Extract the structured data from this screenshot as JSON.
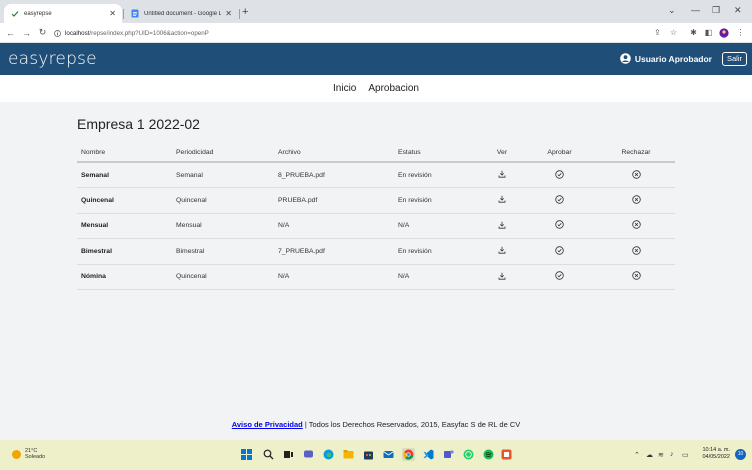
{
  "browser": {
    "tabs": [
      {
        "title": "easyrepse",
        "active": true
      },
      {
        "title": "Untitled document - Google Doc",
        "active": false
      }
    ],
    "url_host": "localhost",
    "url_path": "/repse/index.php?UID=1006&action=openP"
  },
  "header": {
    "brand": "easyrepse",
    "user_name": "Usuario Aprobador",
    "logout_label": "Salir",
    "color": "#1f4e79"
  },
  "nav": {
    "items": [
      "Inicio",
      "Aprobacion"
    ]
  },
  "main": {
    "title": "Empresa 1 2022-02",
    "columns": [
      "Nombre",
      "Periodicidad",
      "Archivo",
      "Estatus",
      "Ver",
      "Aprobar",
      "Rechazar"
    ],
    "rows": [
      {
        "nombre": "Semanal",
        "periodicidad": "Semanal",
        "archivo": "8_PRUEBA.pdf",
        "estatus": "En revisión"
      },
      {
        "nombre": "Quincenal",
        "periodicidad": "Quincenal",
        "archivo": "PRUEBA.pdf",
        "estatus": "En revisión"
      },
      {
        "nombre": "Mensual",
        "periodicidad": "Mensual",
        "archivo": "N/A",
        "estatus": "N/A"
      },
      {
        "nombre": "Bimestral",
        "periodicidad": "Bimestral",
        "archivo": "7_PRUEBA.pdf",
        "estatus": "En revisión"
      },
      {
        "nombre": "Nómina",
        "periodicidad": "Quincenal",
        "archivo": "N/A",
        "estatus": "N/A"
      }
    ],
    "row_icons": {
      "ver": "download-icon",
      "aprobar": "check-circle-icon",
      "rechazar": "x-circle-icon"
    }
  },
  "footer": {
    "privacy_link": "Aviso de Privacidad",
    "text": " | Todos los Derechos Reservados, 2015,  Easyfac S de RL de CV"
  },
  "taskbar": {
    "temperature": "21°C",
    "weather": "Soleado",
    "time": "10:14 a. m.",
    "date": "04/05/2022",
    "notification_count": "10"
  }
}
